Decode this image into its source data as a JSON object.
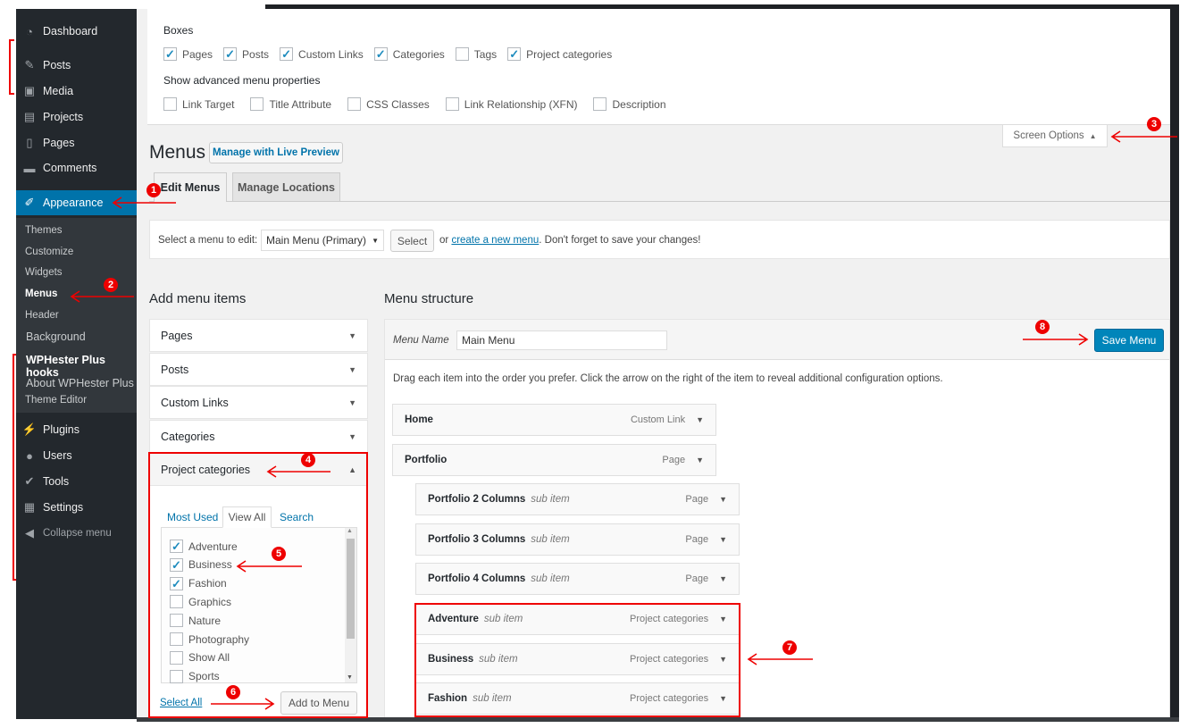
{
  "sidebar": {
    "items": [
      {
        "label": "Dashboard",
        "icon": "dashboard-icon"
      },
      {
        "label": "Posts",
        "icon": "pin-icon"
      },
      {
        "label": "Media",
        "icon": "media-icon"
      },
      {
        "label": "Projects",
        "icon": "portfolio-icon"
      },
      {
        "label": "Pages",
        "icon": "pages-icon"
      },
      {
        "label": "Comments",
        "icon": "comment-icon"
      },
      {
        "label": "Appearance",
        "icon": "brush-icon"
      },
      {
        "label": "Plugins",
        "icon": "plugin-icon"
      },
      {
        "label": "Users",
        "icon": "user-icon"
      },
      {
        "label": "Tools",
        "icon": "wrench-icon"
      },
      {
        "label": "Settings",
        "icon": "settings-icon"
      },
      {
        "label": "Collapse menu",
        "icon": "collapse-icon"
      }
    ],
    "submenu": [
      "Themes",
      "Customize",
      "Widgets",
      "Menus",
      "Header",
      "Background",
      "WPHester Plus hooks",
      "About WPHester Plus",
      "Theme Editor"
    ]
  },
  "screen_options": {
    "boxes_label": "Boxes",
    "boxes": [
      {
        "label": "Pages",
        "checked": true
      },
      {
        "label": "Posts",
        "checked": true
      },
      {
        "label": "Custom Links",
        "checked": true
      },
      {
        "label": "Categories",
        "checked": true
      },
      {
        "label": "Tags",
        "checked": false
      },
      {
        "label": "Project categories",
        "checked": true
      }
    ],
    "advanced_label": "Show advanced menu properties",
    "advanced": [
      {
        "label": "Link Target",
        "checked": false
      },
      {
        "label": "Title Attribute",
        "checked": false
      },
      {
        "label": "CSS Classes",
        "checked": false
      },
      {
        "label": "Link Relationship (XFN)",
        "checked": false
      },
      {
        "label": "Description",
        "checked": false
      }
    ],
    "tab_label": "Screen Options"
  },
  "header": {
    "title": "Menus",
    "live_preview": "Manage with Live Preview",
    "tabs": [
      "Edit Menus",
      "Manage Locations"
    ]
  },
  "select_bar": {
    "label": "Select a menu to edit:",
    "selected": "Main Menu (Primary)",
    "select_button": "Select",
    "or": "or",
    "link": "create a new menu",
    "suffix": ". Don't forget to save your changes!"
  },
  "add_items": {
    "title": "Add menu items",
    "sections": [
      "Pages",
      "Posts",
      "Custom Links",
      "Categories",
      "Project categories"
    ],
    "tabs": [
      "Most Used",
      "View All",
      "Search"
    ],
    "list": [
      {
        "label": "Adventure",
        "checked": true
      },
      {
        "label": "Business",
        "checked": true
      },
      {
        "label": "Fashion",
        "checked": true
      },
      {
        "label": "Graphics",
        "checked": false
      },
      {
        "label": "Nature",
        "checked": false
      },
      {
        "label": "Photography",
        "checked": false
      },
      {
        "label": "Show All",
        "checked": false
      },
      {
        "label": "Sports",
        "checked": false
      }
    ],
    "select_all": "Select All",
    "add_button": "Add to Menu"
  },
  "structure": {
    "title": "Menu structure",
    "name_label": "Menu Name",
    "name_value": "Main Menu",
    "save": "Save Menu",
    "instructions": "Drag each item into the order you prefer. Click the arrow on the right of the item to reveal additional configuration options.",
    "items": [
      {
        "title": "Home",
        "sub": "",
        "type": "Custom Link"
      },
      {
        "title": "Portfolio",
        "sub": "",
        "type": "Page"
      },
      {
        "title": "Portfolio 2 Columns",
        "sub": "sub item",
        "type": "Page"
      },
      {
        "title": "Portfolio 3 Columns",
        "sub": "sub item",
        "type": "Page"
      },
      {
        "title": "Portfolio 4 Columns",
        "sub": "sub item",
        "type": "Page"
      },
      {
        "title": "Adventure",
        "sub": "sub item",
        "type": "Project categories"
      },
      {
        "title": "Business",
        "sub": "sub item",
        "type": "Project categories"
      },
      {
        "title": "Fashion",
        "sub": "sub item",
        "type": "Project categories"
      }
    ]
  },
  "annotations": [
    "1",
    "2",
    "3",
    "4",
    "5",
    "6",
    "7",
    "8"
  ],
  "colors": {
    "sidebar": "#23282d",
    "accent": "#0073aa",
    "save": "#0085ba",
    "annotation": "#ee0000"
  }
}
